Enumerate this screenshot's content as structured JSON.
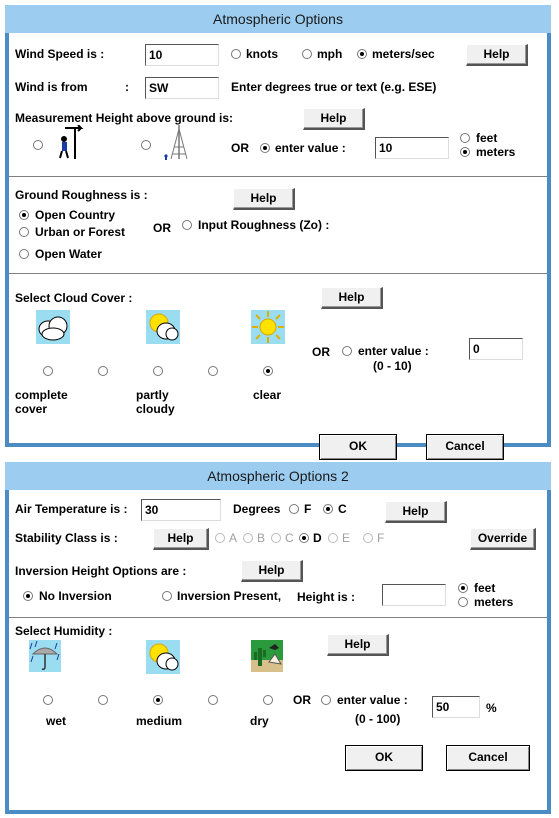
{
  "win1": {
    "title": "Atmospheric Options",
    "wind_speed_label": "Wind Speed is :",
    "wind_speed_value": "10",
    "unit_knots": "knots",
    "unit_mph": "mph",
    "unit_ms": "meters/sec",
    "wind_from_label": "Wind is from",
    "wind_from_colon": ":",
    "wind_from_value": "SW",
    "wind_from_hint": "Enter degrees true or text (e.g. ESE)",
    "meas_height_label": "Measurement Height above ground is:",
    "or_label": "OR",
    "enter_value_label": "enter value :",
    "meas_height_value": "10",
    "unit_feet": "feet",
    "unit_meters": "meters",
    "roughness_label": "Ground Roughness is :",
    "rough_open_country": "Open Country",
    "rough_urban": "Urban or Forest",
    "rough_open_water": "Open Water",
    "input_roughness": "Input Roughness (Zo) :",
    "cloud_label": "Select Cloud Cover :",
    "cloud_value": "0",
    "cloud_range": "(0 - 10)",
    "cloud_complete": [
      "complete",
      "cover"
    ],
    "cloud_partly": [
      "partly",
      "cloudy"
    ],
    "cloud_clear": "clear",
    "help": "Help",
    "ok": "OK",
    "cancel": "Cancel"
  },
  "win2": {
    "title": "Atmospheric Options 2",
    "air_temp_label": "Air Temperature is :",
    "air_temp_value": "30",
    "degrees_label": "Degrees",
    "unit_f": "F",
    "unit_c": "C",
    "stability_label": "Stability Class is :",
    "stability_classes": [
      "A",
      "B",
      "C",
      "D",
      "E",
      "F"
    ],
    "override": "Override",
    "inversion_label": "Inversion Height Options are :",
    "no_inversion": "No Inversion",
    "inversion_present": "Inversion Present,",
    "height_is": "Height is :",
    "unit_feet": "feet",
    "unit_meters": "meters",
    "humidity_label": "Select Humidity :",
    "hum_wet": "wet",
    "hum_medium": "medium",
    "hum_dry": "dry",
    "or_label": "OR",
    "enter_value_label": "enter value :",
    "humidity_value": "50",
    "percent": "%",
    "humidity_range": "(0 - 100)",
    "help": "Help",
    "ok": "OK",
    "cancel": "Cancel"
  }
}
